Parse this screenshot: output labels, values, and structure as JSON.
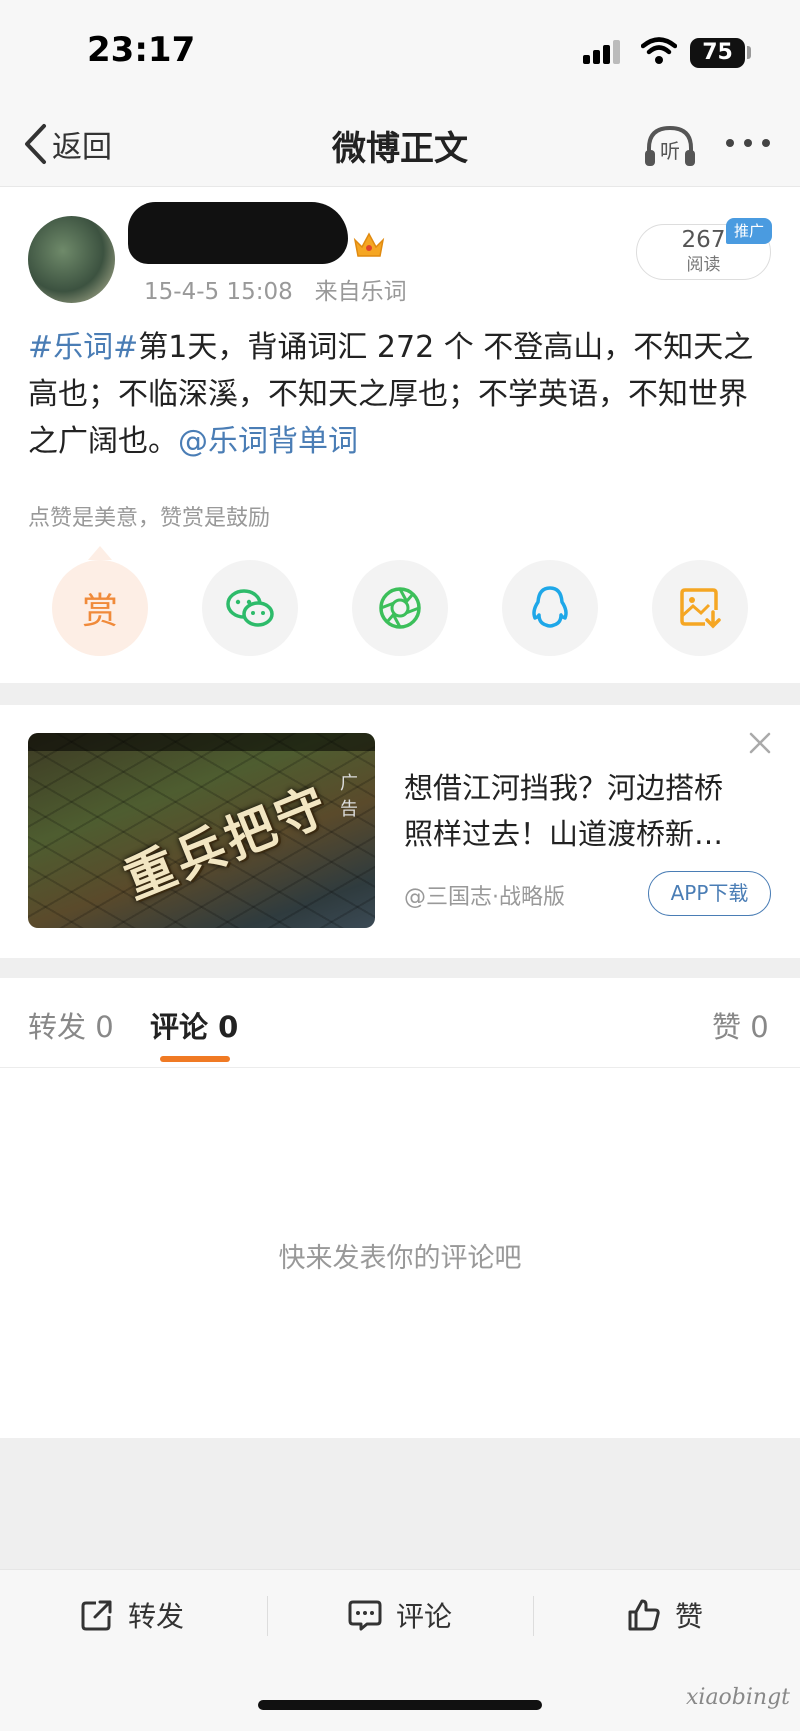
{
  "status_bar": {
    "time": "23:17",
    "battery": "75"
  },
  "navbar": {
    "back_label": "返回",
    "title": "微博正文",
    "listen_label": "听"
  },
  "post": {
    "timestamp": "15-4-5 15:08",
    "source": "来自乐词",
    "read_count": "267",
    "read_label": "阅读",
    "promo_tag": "推广",
    "hashtag": "#乐词#",
    "body": "第1天，背诵词汇 272 个 不登高山，不知天之高也；不临深溪，不知天之厚也；不学英语，不知世界之广阔也。",
    "mention": "@乐词背单词",
    "reward_hint": "点赞是美意，赞赏是鼓励",
    "reward_label": "赏",
    "share_targets": [
      "reward-button",
      "wechat-share-button",
      "moments-share-button",
      "qq-share-button",
      "save-image-button"
    ],
    "colors": {
      "link": "#4a7db5",
      "reward": "#f08a3a",
      "wechat": "#2dbb6a",
      "moments": "#3cbf5a",
      "qq": "#1ea7e8",
      "save_image": "#f5a623"
    }
  },
  "ad": {
    "image_caption": "重兵把守",
    "tag": "广告",
    "title": "想借江河挡我？河边搭桥照样过去！山道渡桥新…",
    "source": "@三国志·战略版",
    "download_label": "APP下载"
  },
  "tabs": [
    {
      "label": "转发",
      "count": "0",
      "active": false
    },
    {
      "label": "评论",
      "count": "0",
      "active": true
    },
    {
      "label": "赞",
      "count": "0",
      "active": false
    }
  ],
  "tab_indicator_color": "#f07a24",
  "comments": {
    "empty_hint": "快来发表你的评论吧"
  },
  "bottom_bar": {
    "repost_label": "转发",
    "comment_label": "评论",
    "like_label": "赞"
  },
  "watermark": "xiaobingt"
}
